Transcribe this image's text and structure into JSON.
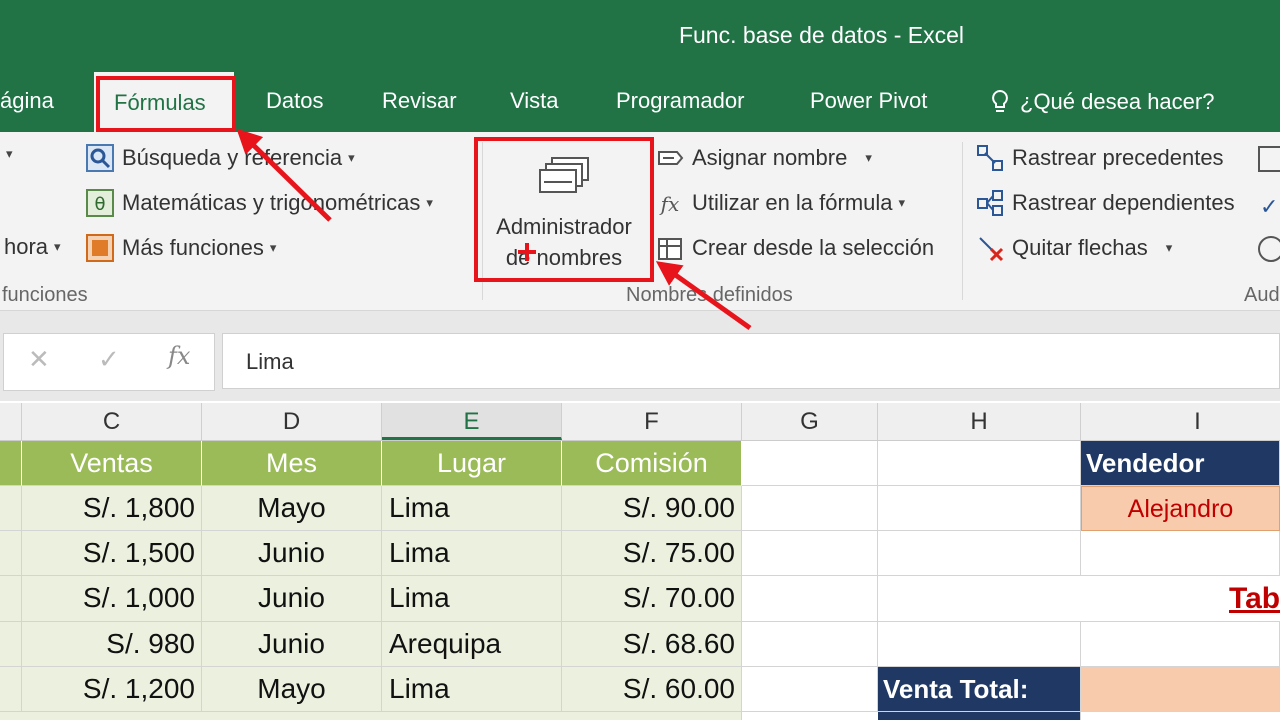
{
  "window": {
    "title": "Func. base de datos  -  Excel"
  },
  "tabs": [
    "ágina",
    "Fórmulas",
    "Datos",
    "Revisar",
    "Vista",
    "Programador",
    "Power Pivot"
  ],
  "tell_me": "¿Qué desea hacer?",
  "ribbon": {
    "func_library": {
      "lookup": "Búsqueda y referencia",
      "math": "Matemáticas y trigonométricas",
      "time": "hora",
      "more": "Más funciones",
      "group_label": "funciones"
    },
    "defined_names": {
      "manager_line1": "Administrador",
      "manager_line2": "de nombres",
      "define": "Asignar nombre",
      "use": "Utilizar en la fórmula",
      "create": "Crear desde la selección",
      "group_label": "Nombres definidos"
    },
    "auditing": {
      "precedents": "Rastrear precedentes",
      "dependents": "Rastrear dependientes",
      "remove": "Quitar flechas",
      "group_label": "Aud"
    }
  },
  "formula_bar": {
    "cancel": "✕",
    "enter": "✓",
    "fx": "fx",
    "value": "Lima"
  },
  "columns": [
    "C",
    "D",
    "E",
    "F",
    "G",
    "H",
    "I"
  ],
  "table": {
    "headers": [
      "Ventas",
      "Mes",
      "Lugar",
      "Comisión"
    ],
    "rows": [
      [
        "S/. 1,800",
        "Mayo",
        "Lima",
        "S/. 90.00"
      ],
      [
        "S/. 1,500",
        "Junio",
        "Lima",
        "S/. 75.00"
      ],
      [
        "S/. 1,000",
        "Junio",
        "Lima",
        "S/. 70.00"
      ],
      [
        "S/. 980",
        "Junio",
        "Arequipa",
        "S/. 68.60"
      ],
      [
        "S/. 1,200",
        "Mayo",
        "Lima",
        "S/. 60.00"
      ]
    ]
  },
  "side": {
    "vendedor_label": "Vendedor",
    "vendedor_value": "Alejandro",
    "tab_partial": "Tab",
    "venta_total_label": "Venta Total:"
  },
  "colors": {
    "excel_green": "#217346",
    "header_green": "#9bbb59",
    "light_green": "#ebf1de",
    "navy": "#1f3864",
    "peach": "#f8cbad",
    "annotation_red": "#e8141c"
  }
}
